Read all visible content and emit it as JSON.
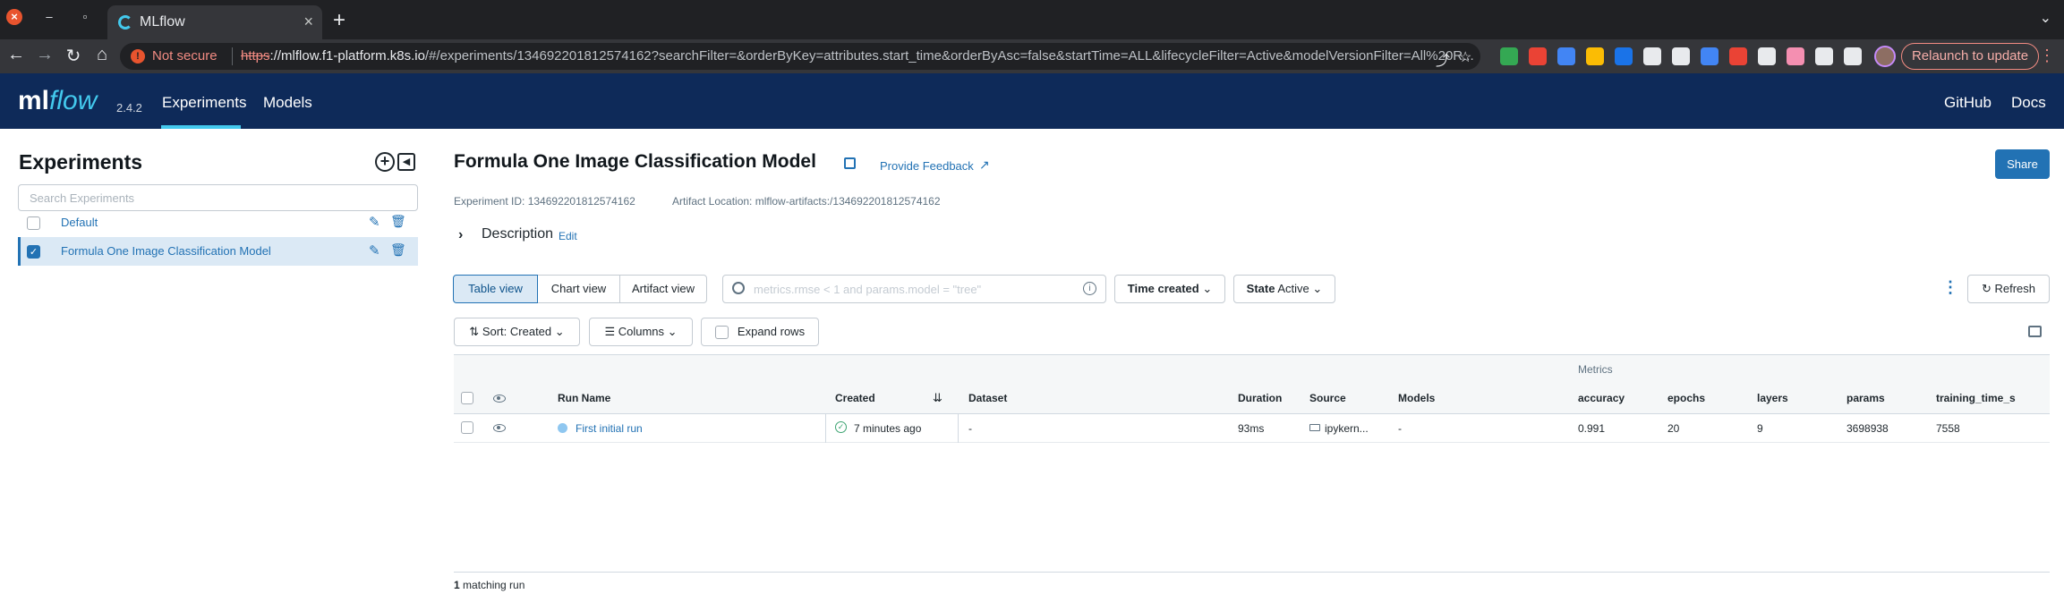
{
  "browser": {
    "tab_title": "MLflow",
    "tab_close": "×",
    "new_tab": "+",
    "ssl_label": "Not secure",
    "url_scheme": "https",
    "url_host": "://mlflow.f1-platform.k8s.io",
    "url_rest": "/#/experiments/134692201812574162?searchFilter=&orderByKey=attributes.start_time&orderByAsc=false&startTime=ALL&lifecycleFilter=Active&modelVersionFilter=All%20R...",
    "relaunch_label": "Relaunch to update",
    "extension_colors": [
      "#34a853",
      "#ea4335",
      "#4285f4",
      "#fbbc04",
      "#1a73e8",
      "#e8eaed",
      "#e8eaed",
      "#4285f4",
      "#ea4335",
      "#e8eaed",
      "#f48fb1",
      "#e8eaed",
      "#e8eaed"
    ]
  },
  "app": {
    "logo_ml": "ml",
    "logo_flow": "flow",
    "version": "2.4.2",
    "nav": {
      "experiments": "Experiments",
      "models": "Models",
      "github": "GitHub",
      "docs": "Docs"
    }
  },
  "sidebar": {
    "title": "Experiments",
    "search_placeholder": "Search Experiments",
    "items": [
      {
        "name": "Default",
        "checked": false
      },
      {
        "name": "Formula One Image Classification Model",
        "checked": true
      }
    ]
  },
  "experiment": {
    "title": "Formula One Image Classification Model",
    "feedback_label": "Provide Feedback",
    "share_label": "Share",
    "id_text": "Experiment ID: 134692201812574162",
    "artifact_text": "Artifact Location: mlflow-artifacts:/134692201812574162",
    "description_label": "Description",
    "description_edit": "Edit"
  },
  "toolbar": {
    "views": [
      "Table view",
      "Chart view",
      "Artifact view"
    ],
    "search_placeholder": "metrics.rmse < 1 and params.model = \"tree\"",
    "time_label": "Time created",
    "state_label": "State",
    "state_value": "Active",
    "refresh_label": "Refresh",
    "sort_label": "Sort: Created",
    "columns_label": "Columns",
    "expand_label": "Expand rows"
  },
  "table": {
    "group_label": "Metrics",
    "headers": {
      "run_name": "Run Name",
      "created": "Created",
      "dataset": "Dataset",
      "duration": "Duration",
      "source": "Source",
      "models": "Models",
      "accuracy": "accuracy",
      "epochs": "epochs",
      "layers": "layers",
      "params": "params",
      "training_time": "training_time_s"
    },
    "rows": [
      {
        "run_name": "First initial run",
        "created": "7 minutes ago",
        "dataset": "-",
        "duration": "93ms",
        "source": "ipykern...",
        "models": "-",
        "accuracy": "0.991",
        "epochs": "20",
        "layers": "9",
        "params": "3698938",
        "training_time": "7558"
      }
    ]
  },
  "footer": {
    "count": "1",
    "label": "matching run"
  }
}
